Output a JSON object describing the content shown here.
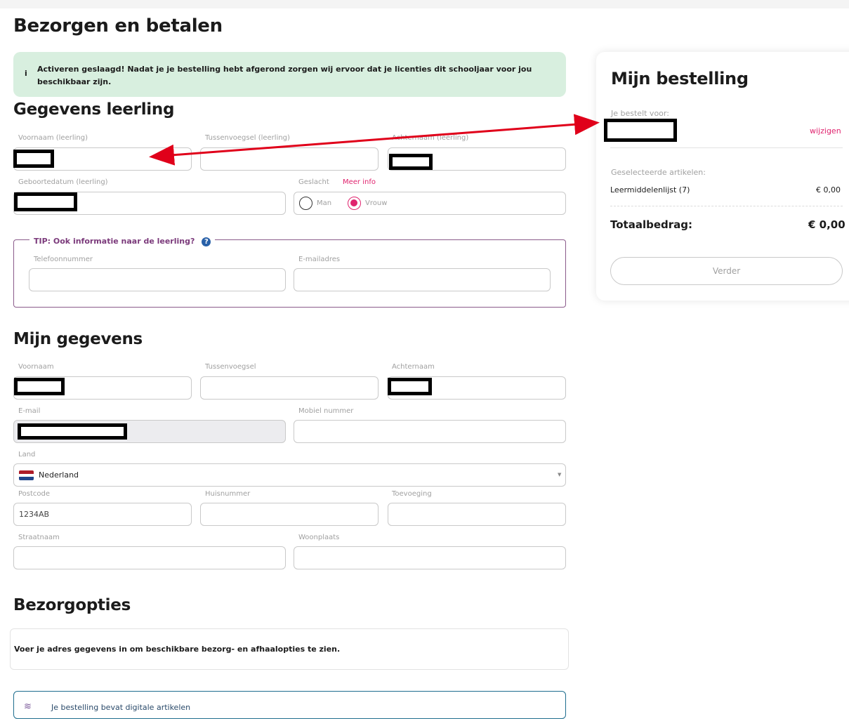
{
  "page": {
    "title": "Bezorgen en betalen"
  },
  "alert": {
    "icon": "i",
    "message": "Activeren geslaagd! Nadat je je bestelling hebt afgerond zorgen wij ervoor dat je licenties dit schooljaar voor jou beschikbaar zijn."
  },
  "student": {
    "heading": "Gegevens leerling",
    "first_name_label": "Voornaam (leerling)",
    "middle_name_label": "Tussenvoegsel (leerling)",
    "last_name_label": "Achternaam (leerling)",
    "birthdate_label": "Geboortedatum (leerling)",
    "gender_label": "Geslacht",
    "more_info": "Meer info",
    "gender_male": "Man",
    "gender_female": "Vrouw",
    "gender_selected": "Vrouw"
  },
  "tip": {
    "title": "TIP:  Ook informatie naar de leerling?",
    "icon": "question-icon",
    "phone_label": "Telefoonnummer",
    "email_label": "E-mailadres"
  },
  "mine": {
    "heading": "Mijn gegevens",
    "first_name_label": "Voornaam",
    "middle_name_label": "Tussenvoegsel",
    "last_name_label": "Achternaam",
    "email_label": "E-mail",
    "mobile_label": "Mobiel nummer",
    "country_label": "Land",
    "country_value": "Nederland",
    "postcode_label": "Postcode",
    "postcode_value": "1234AB",
    "house_number_label": "Huisnummer",
    "addition_label": "Toevoeging",
    "street_label": "Straatnaam",
    "city_label": "Woonplaats"
  },
  "delivery": {
    "heading": "Bezorgopties",
    "info": "Voer je adres gegevens in om beschikbare bezorg- en afhaalopties te zien.",
    "digital_notice": "Je bestelling bevat digitale artikelen"
  },
  "order": {
    "title": "Mijn bestelling",
    "ordering_for_label": "Je bestelt voor:",
    "change_link": "wijzigen",
    "selected_label": "Geselecteerde artikelen:",
    "item_name": "Leermiddelenlijst (7)",
    "item_price": "€ 0,00",
    "total_label": "Totaalbedrag:",
    "total_value": "€ 0,00",
    "next_button": "Verder"
  },
  "colors": {
    "accent": "#e0236e",
    "annotation_arrow": "#e0001a",
    "alert_bg": "#d8efdf",
    "tip_border": "#8a5a8a"
  }
}
